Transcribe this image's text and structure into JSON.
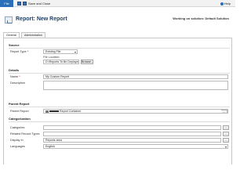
{
  "ribbon": {
    "file_label": "File",
    "save_close_label": "Save and Close",
    "help_label": "Help"
  },
  "header": {
    "title": "Report: New Report",
    "solution_text": "Working on solution: Default Solution"
  },
  "tabs": [
    {
      "label": "General"
    },
    {
      "label": "Administration"
    }
  ],
  "sections": {
    "source": "Source",
    "details": "Details",
    "parent_report": "Parent Report",
    "categorization": "Categorization"
  },
  "fields": {
    "report_type": {
      "label": "Report Type",
      "value": "Existing File"
    },
    "file_location": {
      "label": "File Location:",
      "value": "D:\\Reports To Be Deployed\\C",
      "browse": "Browse..."
    },
    "name": {
      "label": "Name",
      "value": "My Custom Report"
    },
    "description": {
      "label": "Description",
      "value": ""
    },
    "parent_report": {
      "label": "Parent Report",
      "value": "Report Container"
    },
    "categories": {
      "label": "Categories",
      "value": ""
    },
    "related_record_types": {
      "label": "Related Record Types",
      "value": ""
    },
    "display_in": {
      "label": "Display In",
      "value": "Reports area"
    },
    "languages": {
      "label": "Languages",
      "value": "English"
    }
  },
  "required_marker": "*",
  "lookup_glyph": "..."
}
